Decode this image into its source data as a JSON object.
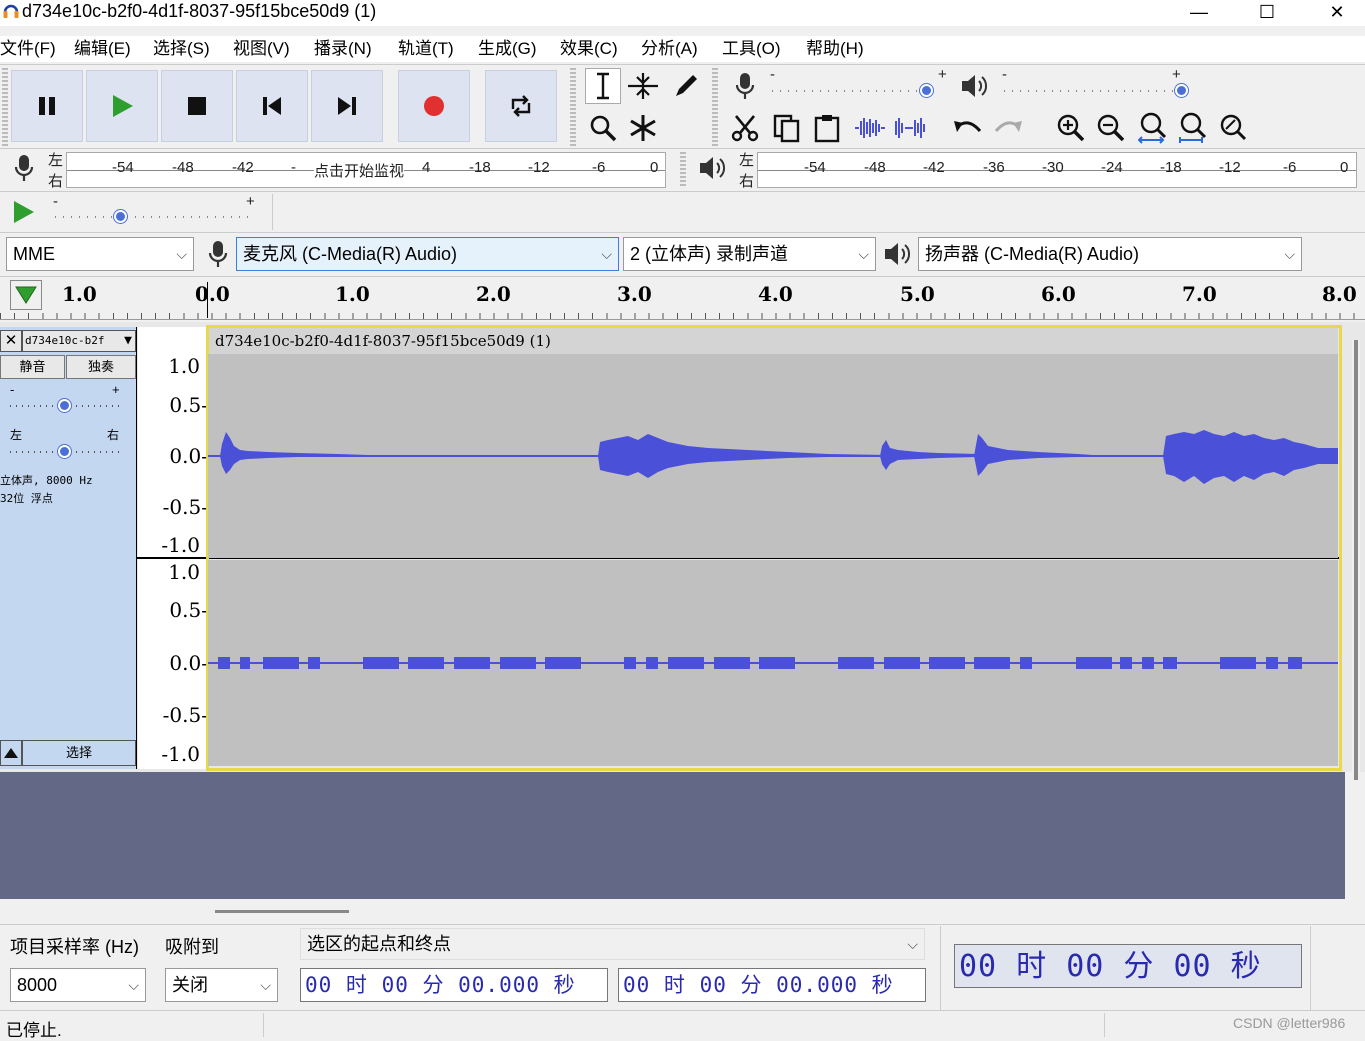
{
  "window": {
    "title": "d734e10c-b2f0-4d1f-8037-95f15bce50d9 (1)",
    "minimize": "—",
    "maximize": "☐",
    "close": "✕"
  },
  "menu": [
    "文件(F)",
    "编辑(E)",
    "选择(S)",
    "视图(V)",
    "播录(N)",
    "轨道(T)",
    "生成(G)",
    "效果(C)",
    "分析(A)",
    "工具(O)",
    "帮助(H)"
  ],
  "colors": {
    "accent": "#4b50d8",
    "wave_bg": "#c0c0c0",
    "track_panel": "#c4d7f0",
    "empty_area": "#626886",
    "record": "#e03030",
    "play": "#2e9e2e"
  },
  "record_meter": {
    "left_label": "左",
    "right_label": "右",
    "ticks": [
      "-54",
      "-48",
      "-42",
      "-",
      "点击开始监视",
      "4",
      "-18",
      "-12",
      "-6",
      "0"
    ]
  },
  "play_meter": {
    "left_label": "左",
    "right_label": "右",
    "ticks": [
      "-54",
      "-48",
      "-42",
      "-36",
      "-30",
      "-24",
      "-18",
      "-12",
      "-6",
      "0"
    ]
  },
  "sliders": {
    "minus": "-",
    "plus": "+"
  },
  "device": {
    "host": "MME",
    "input": "麦克风 (C-Media(R) Audio)",
    "channels": "2 (立体声) 录制声道",
    "output": "扬声器 (C-Media(R) Audio)"
  },
  "timeline": [
    "1.0",
    "0.0",
    "1.0",
    "2.0",
    "3.0",
    "4.0",
    "5.0",
    "6.0",
    "7.0",
    "8.0"
  ],
  "track": {
    "name_short": "d734e10c-b2f",
    "title": "d734e10c-b2f0-4d1f-8037-95f15bce50d9 (1)",
    "mute": "静音",
    "solo": "独奏",
    "gain_minus": "-",
    "gain_plus": "+",
    "pan_left": "左",
    "pan_right": "右",
    "info_line1": "立体声, 8000 Hz",
    "info_line2": "32位 浮点",
    "select": "选择",
    "close": "✕"
  },
  "vscale": [
    "1.0",
    "0.5-",
    "0.0-",
    "-0.5-",
    "-1.0"
  ],
  "selection_toolbar": {
    "rate_label": "项目采样率 (Hz)",
    "snap_label": "吸附到",
    "sel_label": "选区的起点和终点",
    "rate_value": "8000",
    "snap_value": "关闭",
    "start_time": "00 时 00 分 00.000 秒",
    "end_time": "00 时 00 分 00.000 秒",
    "audio_pos": "00 时 00 分 00 秒"
  },
  "status": {
    "text": "已停止.",
    "watermark": "CSDN @letter986"
  }
}
